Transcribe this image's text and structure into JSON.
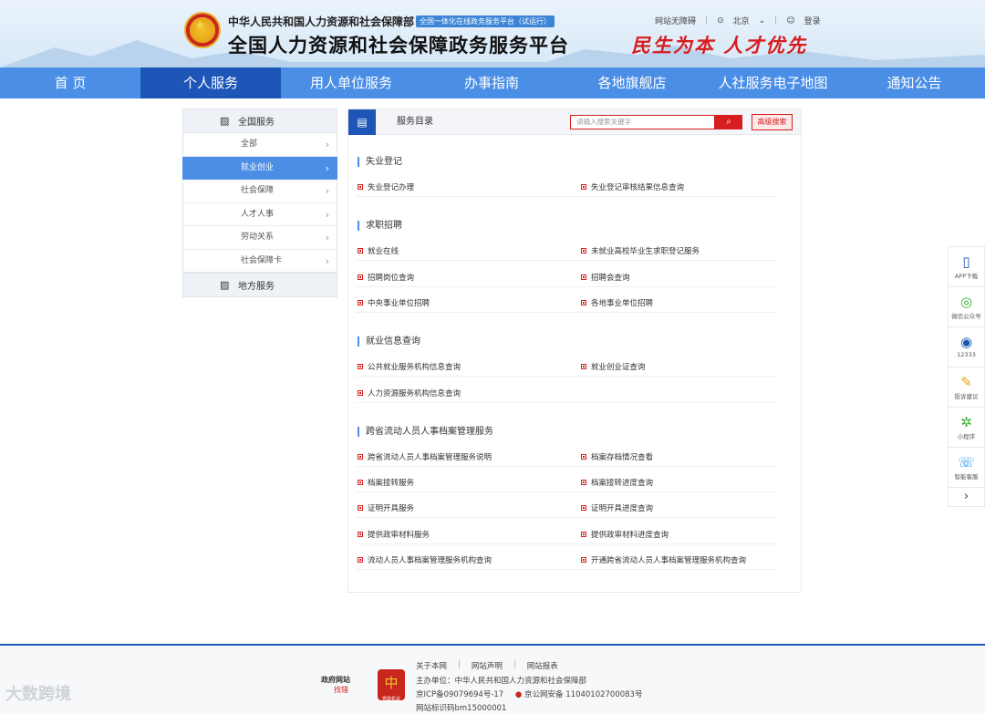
{
  "header": {
    "ministry": "中华人民共和国人力资源和社会保障部",
    "beta_badge": "全国一体化在线政务服务平台（试运行）",
    "platform_title": "全国人力资源和社会保障政务服务平台",
    "slogan": "民生为本 人才优先",
    "accessibility": "网站无障碍",
    "region": "北京",
    "login": "登录"
  },
  "nav": [
    {
      "label": "首 页",
      "active": false
    },
    {
      "label": "个人服务",
      "active": true
    },
    {
      "label": "用人单位服务",
      "active": false
    },
    {
      "label": "办事指南",
      "active": false
    },
    {
      "label": "各地旗舰店",
      "active": false
    },
    {
      "label": "人社服务电子地图",
      "active": false
    },
    {
      "label": "通知公告",
      "active": false
    }
  ],
  "sidebar": {
    "national_title": "全国服务",
    "items": [
      "全部",
      "就业创业",
      "社会保障",
      "人才人事",
      "劳动关系",
      "社会保障卡"
    ],
    "active_index": 1,
    "local_title": "地方服务"
  },
  "catalog": {
    "title": "服务目录",
    "search_placeholder": "请输入搜索关键字",
    "advanced_search": "高级搜索",
    "sections": [
      {
        "title": "失业登记",
        "rows": [
          [
            "失业登记办理",
            "失业登记审核结果信息查询"
          ]
        ]
      },
      {
        "title": "求职招聘",
        "rows": [
          [
            "就业在线",
            "未就业高校毕业生求职登记服务"
          ],
          [
            "招聘岗位查询",
            "招聘会查询"
          ],
          [
            "中央事业单位招聘",
            "各地事业单位招聘"
          ]
        ]
      },
      {
        "title": "就业信息查询",
        "rows": [
          [
            "公共就业服务机构信息查询",
            "就业创业证查询"
          ],
          [
            "人力资源服务机构信息查询",
            ""
          ]
        ]
      },
      {
        "title": "跨省流动人员人事档案管理服务",
        "rows": [
          [
            "跨省流动人员人事档案管理服务说明",
            "档案存档情况查看"
          ],
          [
            "档案接转服务",
            "档案接转进度查询"
          ],
          [
            "证明开具服务",
            "证明开具进度查询"
          ],
          [
            "提供政审材料服务",
            "提供政审材料进度查询"
          ],
          [
            "流动人员人事档案管理服务机构查询",
            "开通跨省流动人员人事档案管理服务机构查询"
          ]
        ]
      }
    ]
  },
  "right_bar": [
    {
      "label": "APP下载",
      "icon": "phone-icon"
    },
    {
      "label": "微信公众号",
      "icon": "wechat-icon"
    },
    {
      "label": "12333",
      "icon": "12333-icon"
    },
    {
      "label": "投诉建议",
      "icon": "edit-icon"
    },
    {
      "label": "小程序",
      "icon": "mini-program-icon"
    },
    {
      "label": "智能客服",
      "icon": "chat-icon"
    }
  ],
  "footer": {
    "links": [
      "关于本网",
      "网站声明",
      "网站报表"
    ],
    "sponsor": "主办单位：中华人民共和国人力资源和社会保障部",
    "icp": "京ICP备09079694号-17",
    "police": "京公网安备 11040102700083号",
    "site_code": "网站标识码bm15000001",
    "gov_logo_line1": "政府网站",
    "gov_logo_line2": "找错",
    "party_logo": "党政机关"
  },
  "watermark": "大数跨境"
}
